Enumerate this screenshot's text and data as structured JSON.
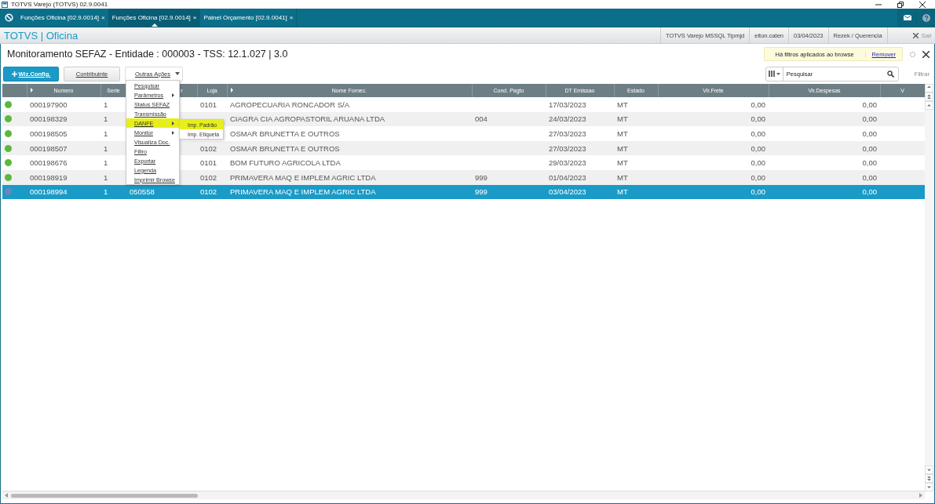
{
  "window": {
    "title": "TOTVS Varejo (TOTVS) 02.9.0041"
  },
  "tabs": [
    {
      "label": "Funções Oficina [02.9.0014]",
      "close": "×",
      "selected": false
    },
    {
      "label": "Funções Oficina [02.9.0014]",
      "close": "×",
      "selected": true
    },
    {
      "label": "Painel Orçamento [02.9.0041]",
      "close": "×",
      "selected": false
    }
  ],
  "header": {
    "app_title": "TOTVS | Oficina",
    "info": [
      "TOTVS Varejo MSSQL Tipmjd",
      "elton.caten",
      "03/04/2023",
      "Rezek / Querencia"
    ],
    "exit": "Sair"
  },
  "page_title": "Monitoramento SEFAZ - Entidade : 000003 - TSS: 12.1.027 | 3.0",
  "filter_notice": {
    "text": "Há filtros aplicados ao browse",
    "link": "Remover"
  },
  "buttons": [
    {
      "label": "Wiz.Config.",
      "kind": "primary"
    },
    {
      "label": "Contribuinte",
      "kind": "default"
    },
    {
      "label": "Outras Ações",
      "kind": "dropdown"
    }
  ],
  "search": {
    "placeholder": "Pesquisar"
  },
  "filter_button": "Filtrar",
  "table": {
    "columns": [
      {
        "label": "Numero",
        "sort": true
      },
      {
        "label": "Serie",
        "sort": false
      },
      {
        "label": "r",
        "sort": false
      },
      {
        "label": "Loja",
        "sort": false
      },
      {
        "label": "Nome Fornec.",
        "sort": true
      },
      {
        "label": "Cond. Pagto",
        "sort": false
      },
      {
        "label": "DT Emissao",
        "sort": false
      },
      {
        "label": "Estado",
        "sort": false
      },
      {
        "label": "Vlr.Frete",
        "sort": false
      },
      {
        "label": "Vlr.Despesas",
        "sort": false
      },
      {
        "label": "V",
        "sort": false
      }
    ],
    "rows": [
      {
        "color": "#5cb83c",
        "selected": false,
        "cells": [
          "000197900",
          "1",
          null,
          "0101",
          "AGROPECUARIA RONCADOR S/A",
          null,
          "17/03/2023",
          "MT",
          "0,00",
          "0,00",
          null
        ]
      },
      {
        "color": "#5cb83c",
        "selected": false,
        "cells": [
          "000198329",
          "1",
          null,
          null,
          "CIAGRA CIA AGROPASTORIL ARUANA LTDA",
          "004",
          "24/03/2023",
          "MT",
          "0,00",
          "0,00",
          null
        ]
      },
      {
        "color": "#5cb83c",
        "selected": false,
        "cells": [
          "000198505",
          "1",
          null,
          null,
          "OSMAR BRUNETTA E OUTROS",
          null,
          "27/03/2023",
          "MT",
          "0,00",
          "0,00",
          null
        ]
      },
      {
        "color": "#5cb83c",
        "selected": false,
        "cells": [
          "000198507",
          "1",
          null,
          "0102",
          "OSMAR BRUNETTA E OUTROS",
          null,
          "27/03/2023",
          "MT",
          "0,00",
          "0,00",
          null
        ]
      },
      {
        "color": "#5cb83c",
        "selected": false,
        "cells": [
          "000198676",
          "1",
          null,
          "0101",
          "BOM FUTURO AGRICOLA LTDA",
          null,
          "29/03/2023",
          "MT",
          "0,00",
          "0,00",
          null
        ]
      },
      {
        "color": "#5cb83c",
        "selected": false,
        "cells": [
          "000198919",
          "1",
          null,
          "0102",
          "PRIMAVERA MAQ E IMPLEM AGRIC LTDA",
          "999",
          "01/04/2023",
          "MT",
          "0,00",
          "0,00",
          null
        ]
      },
      {
        "color": "#6a86b8",
        "selected": true,
        "cells": [
          "000198994",
          "1",
          "050558",
          "0102",
          "PRIMAVERA MAQ E IMPLEM AGRIC LTDA",
          "999",
          "03/04/2023",
          "MT",
          "0,00",
          "0,00",
          null
        ]
      }
    ]
  },
  "menu": {
    "items": [
      {
        "label": "Pesquisar",
        "submenu": false,
        "highlighted": false
      },
      {
        "label": "Parâmetros",
        "submenu": true,
        "highlighted": false
      },
      {
        "label": "Status SEFAZ",
        "submenu": false,
        "highlighted": false
      },
      {
        "label": "Transmissão",
        "submenu": false,
        "highlighted": false
      },
      {
        "label": "DANFE",
        "submenu": true,
        "highlighted": true
      },
      {
        "label": "Monitor",
        "submenu": true,
        "highlighted": false
      },
      {
        "label": "Visualiza Doc.",
        "submenu": false,
        "highlighted": false
      },
      {
        "label": "Filtro",
        "submenu": false,
        "highlighted": false
      },
      {
        "label": "Exportar",
        "submenu": false,
        "highlighted": false
      },
      {
        "label": "Legenda",
        "submenu": false,
        "highlighted": false
      },
      {
        "label": "Imprimir Browse",
        "submenu": false,
        "highlighted": false
      }
    ],
    "submenu": [
      {
        "label": "Imp. Padrão",
        "highlighted": true
      },
      {
        "label": "Imp. Etiqueta",
        "highlighted": false
      }
    ]
  }
}
